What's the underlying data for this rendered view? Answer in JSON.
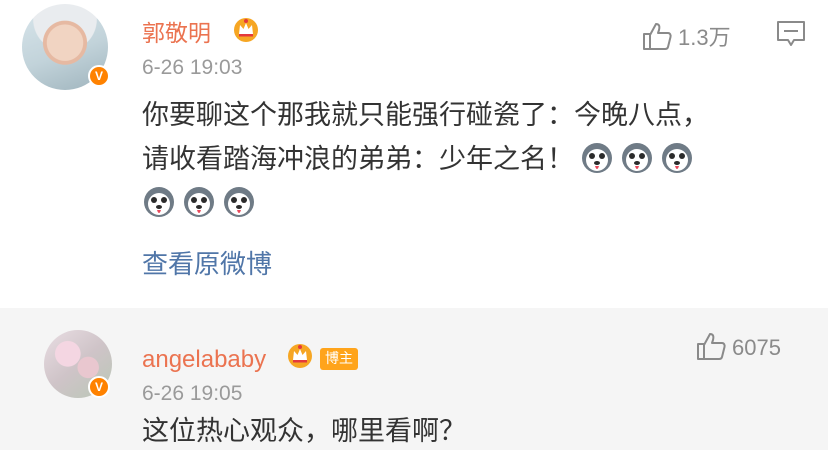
{
  "comments": [
    {
      "username": "郭敬明",
      "time": "6-26 19:03",
      "likes": "1.3万",
      "content_line1": "你要聊这个那我就只能强行碰瓷了：今晚八点，",
      "content_line2": "请收看踏海冲浪的弟弟：少年之名！",
      "emoji_icon": "husky-dog-emoji",
      "view_original": "查看原微博"
    },
    {
      "username": "angelababy",
      "badge": "博主",
      "time": "6-26 19:05",
      "likes": "6075",
      "content": "这位热心观众，哪里看啊？"
    }
  ],
  "colors": {
    "username": "#eb7350",
    "link": "#5076a8",
    "verified_badge": "#ff8200",
    "host_badge": "#ffa41b"
  }
}
